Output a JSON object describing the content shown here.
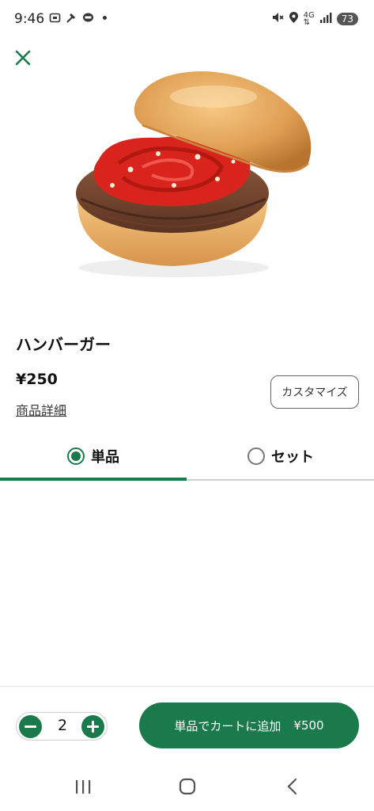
{
  "status_bar": {
    "time": "9:46",
    "network": "4G",
    "battery": "73",
    "icons": [
      "screenshot-icon",
      "hammer-icon",
      "line-icon",
      "dot-icon",
      "mute-icon",
      "location-icon",
      "network-arrows-icon",
      "signal-icon",
      "battery-icon"
    ]
  },
  "product": {
    "name": "ハンバーガー",
    "price": "¥250",
    "details_link": "商品詳細",
    "customize_label": "カスタマイズ"
  },
  "tabs": [
    {
      "label": "単品",
      "selected": true
    },
    {
      "label": "セット",
      "selected": false
    }
  ],
  "order": {
    "quantity": "2",
    "add_to_cart_label": "単品でカートに追加",
    "total": "¥500"
  },
  "colors": {
    "accent": "#1a7a4c",
    "text": "#111111"
  }
}
